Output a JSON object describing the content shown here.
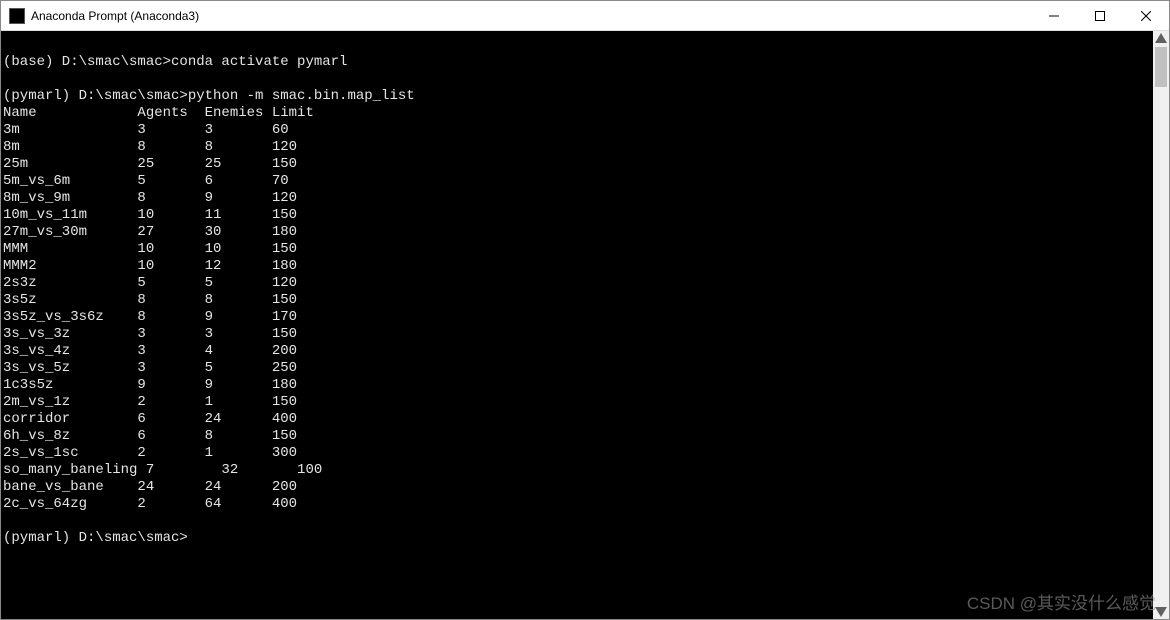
{
  "window": {
    "title": "Anaconda Prompt (Anaconda3)"
  },
  "terminal": {
    "blank_line": "",
    "line1_prompt": "(base) D:\\smac\\smac>",
    "line1_cmd": "conda activate pymarl",
    "line2_prompt": "(pymarl) D:\\smac\\smac>",
    "line2_cmd": "python -m smac.bin.map_list",
    "header": {
      "name": "Name",
      "agents": "Agents",
      "enemies": "Enemies",
      "limit": "Limit"
    },
    "rows": [
      {
        "name": "3m",
        "agents": "3",
        "enemies": "3",
        "limit": "60"
      },
      {
        "name": "8m",
        "agents": "8",
        "enemies": "8",
        "limit": "120"
      },
      {
        "name": "25m",
        "agents": "25",
        "enemies": "25",
        "limit": "150"
      },
      {
        "name": "5m_vs_6m",
        "agents": "5",
        "enemies": "6",
        "limit": "70"
      },
      {
        "name": "8m_vs_9m",
        "agents": "8",
        "enemies": "9",
        "limit": "120"
      },
      {
        "name": "10m_vs_11m",
        "agents": "10",
        "enemies": "11",
        "limit": "150"
      },
      {
        "name": "27m_vs_30m",
        "agents": "27",
        "enemies": "30",
        "limit": "180"
      },
      {
        "name": "MMM",
        "agents": "10",
        "enemies": "10",
        "limit": "150"
      },
      {
        "name": "MMM2",
        "agents": "10",
        "enemies": "12",
        "limit": "180"
      },
      {
        "name": "2s3z",
        "agents": "5",
        "enemies": "5",
        "limit": "120"
      },
      {
        "name": "3s5z",
        "agents": "8",
        "enemies": "8",
        "limit": "150"
      },
      {
        "name": "3s5z_vs_3s6z",
        "agents": "8",
        "enemies": "9",
        "limit": "170"
      },
      {
        "name": "3s_vs_3z",
        "agents": "3",
        "enemies": "3",
        "limit": "150"
      },
      {
        "name": "3s_vs_4z",
        "agents": "3",
        "enemies": "4",
        "limit": "200"
      },
      {
        "name": "3s_vs_5z",
        "agents": "3",
        "enemies": "5",
        "limit": "250"
      },
      {
        "name": "1c3s5z",
        "agents": "9",
        "enemies": "9",
        "limit": "180"
      },
      {
        "name": "2m_vs_1z",
        "agents": "2",
        "enemies": "1",
        "limit": "150"
      },
      {
        "name": "corridor",
        "agents": "6",
        "enemies": "24",
        "limit": "400"
      },
      {
        "name": "6h_vs_8z",
        "agents": "6",
        "enemies": "8",
        "limit": "150"
      },
      {
        "name": "2s_vs_1sc",
        "agents": "2",
        "enemies": "1",
        "limit": "300"
      },
      {
        "name": "so_many_baneling",
        "agents": "7",
        "enemies": "32",
        "limit": "100"
      },
      {
        "name": "bane_vs_bane",
        "agents": "24",
        "enemies": "24",
        "limit": "200"
      },
      {
        "name": "2c_vs_64zg",
        "agents": "2",
        "enemies": "64",
        "limit": "400"
      }
    ],
    "final_prompt": "(pymarl) D:\\smac\\smac>"
  },
  "watermark": "CSDN @其实没什么感觉"
}
